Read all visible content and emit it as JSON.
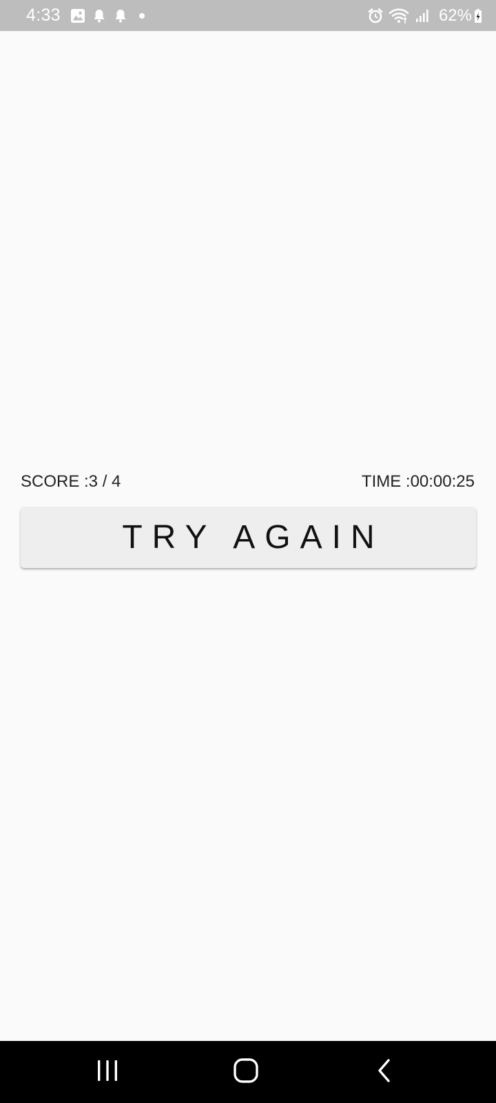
{
  "status_bar": {
    "time": "4:33",
    "battery_percent": "62%",
    "left_icons": [
      "gallery-icon",
      "bell-icon",
      "bell-icon",
      "dot-icon"
    ],
    "right_icons": [
      "alarm-icon",
      "wifi-icon",
      "signal-icon",
      "battery-icon"
    ]
  },
  "game_over": {
    "score_text": "SCORE :3 / 4",
    "time_text": "TIME :00:00:25",
    "try_again_label": "TRY AGAIN"
  },
  "nav_bar": {
    "buttons": [
      "recents-icon",
      "home-icon",
      "back-icon"
    ]
  },
  "colors": {
    "status_bar_bg": "#bdbdbd",
    "page_bg": "#fafafa",
    "button_bg": "#eeeeee",
    "nav_bar_bg": "#000000"
  }
}
